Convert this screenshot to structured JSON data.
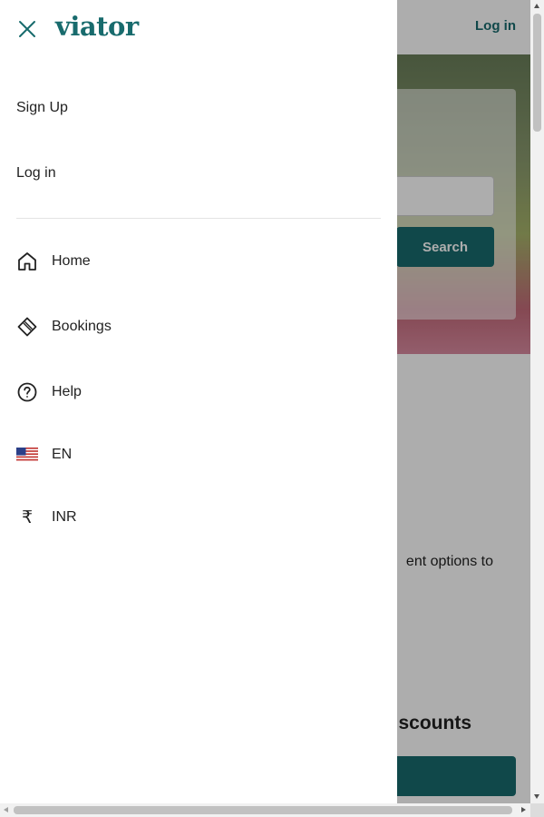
{
  "background_page": {
    "login_label": "Log in",
    "search_button": "Search",
    "promo_text_fragment": "ent options to",
    "deals_title_fragment": "scounts"
  },
  "drawer": {
    "logo": "viator",
    "close_icon": "close-icon",
    "auth": {
      "signup_label": "Sign Up",
      "login_label": "Log in"
    },
    "nav": [
      {
        "label": "Home",
        "icon": "home-icon"
      },
      {
        "label": "Bookings",
        "icon": "ticket-icon"
      },
      {
        "label": "Help",
        "icon": "help-icon"
      },
      {
        "label": "EN",
        "icon": "us-flag-icon"
      },
      {
        "label": "INR",
        "icon": "rupee-icon"
      }
    ]
  },
  "colors": {
    "brand": "#186b6d",
    "overlay": "rgba(0,0,0,0.32)",
    "text": "#222222"
  }
}
